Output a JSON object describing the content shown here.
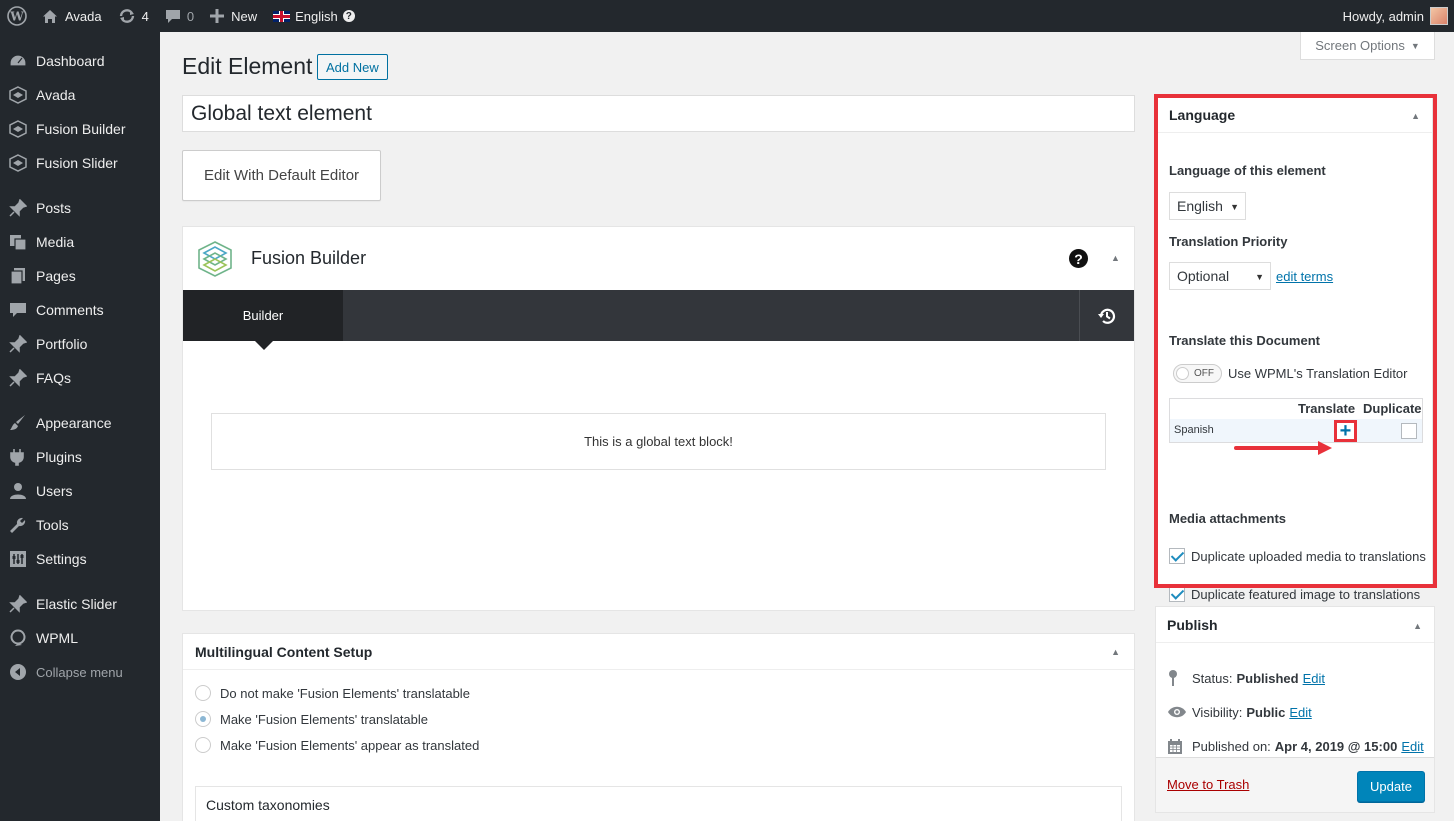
{
  "adminbar": {
    "site_name": "Avada",
    "updates_count": "4",
    "comments_count": "0",
    "new_label": "New",
    "language": "English",
    "howdy": "Howdy, admin"
  },
  "sidebar": {
    "items": [
      {
        "label": "Dashboard",
        "icon": "dashboard-icon"
      },
      {
        "label": "Avada",
        "icon": "avada-icon"
      },
      {
        "label": "Fusion Builder",
        "icon": "fusion-builder-icon"
      },
      {
        "label": "Fusion Slider",
        "icon": "fusion-slider-icon"
      },
      {
        "label": "Posts",
        "icon": "pin-icon"
      },
      {
        "label": "Media",
        "icon": "media-icon"
      },
      {
        "label": "Pages",
        "icon": "pages-icon"
      },
      {
        "label": "Comments",
        "icon": "comment-icon"
      },
      {
        "label": "Portfolio",
        "icon": "pin-icon"
      },
      {
        "label": "FAQs",
        "icon": "pin-icon"
      },
      {
        "label": "Appearance",
        "icon": "brush-icon"
      },
      {
        "label": "Plugins",
        "icon": "plugin-icon"
      },
      {
        "label": "Users",
        "icon": "user-icon"
      },
      {
        "label": "Tools",
        "icon": "wrench-icon"
      },
      {
        "label": "Settings",
        "icon": "settings-icon"
      },
      {
        "label": "Elastic Slider",
        "icon": "pin-icon"
      },
      {
        "label": "WPML",
        "icon": "wpml-icon"
      },
      {
        "label": "Collapse menu",
        "icon": "collapse-icon"
      }
    ]
  },
  "header": {
    "screen_options": "Screen Options",
    "page_title": "Edit Element",
    "add_new": "Add New"
  },
  "editor": {
    "title_value": "Global text element",
    "default_editor_button": "Edit With Default Editor"
  },
  "fusion_builder": {
    "title": "Fusion Builder",
    "help": "?",
    "tab_builder": "Builder",
    "global_block_text": "This is a global text block!"
  },
  "multilingual": {
    "title": "Multilingual Content Setup",
    "options": [
      {
        "label": "Do not make 'Fusion Elements' translatable",
        "checked": false
      },
      {
        "label": "Make 'Fusion Elements' translatable",
        "checked": true
      },
      {
        "label": "Make 'Fusion Elements' appear as translated",
        "checked": false
      }
    ],
    "custom_taxonomies": "Custom taxonomies"
  },
  "language_box": {
    "title": "Language",
    "language_of_element_label": "Language of this element",
    "language_selected": "English",
    "translation_priority_label": "Translation Priority",
    "priority_selected": "Optional",
    "edit_terms": "edit terms",
    "translate_document_label": "Translate this Document",
    "toggle_state": "OFF",
    "toggle_label": "Use WPML's Translation Editor",
    "table_header_translate": "Translate",
    "table_header_duplicate": "Duplicate",
    "table_rows": [
      {
        "language": "Spanish",
        "action": "+"
      }
    ],
    "media_attachments_label": "Media attachments",
    "duplicate_media": "Duplicate uploaded media to translations",
    "duplicate_featured": "Duplicate featured image to translations",
    "highlight_color": "#e8313a"
  },
  "publish_box": {
    "title": "Publish",
    "status_label": "Status:",
    "status_value": "Published",
    "visibility_label": "Visibility:",
    "visibility_value": "Public",
    "published_on_label": "Published on:",
    "published_on_value": "Apr 4, 2019 @ 15:00",
    "edit_link": "Edit",
    "move_to_trash": "Move to Trash",
    "update_button": "Update"
  }
}
